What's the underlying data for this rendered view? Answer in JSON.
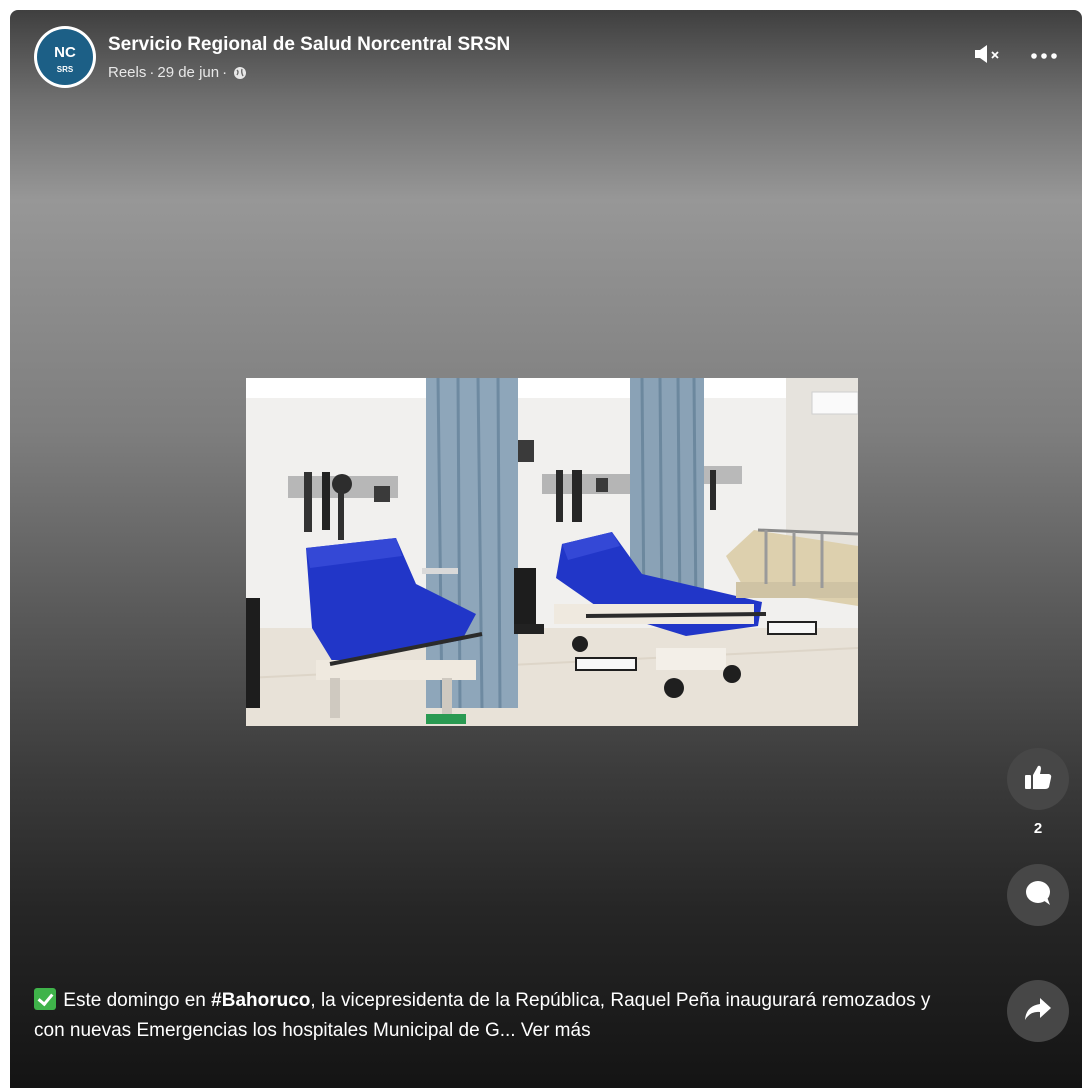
{
  "post": {
    "page_name": "Servicio Regional de Salud Norcentral SRSN",
    "meta_type": "Reels",
    "meta_sep": " · ",
    "meta_date": "29 de jun",
    "avatar_top": "NC",
    "avatar_bottom": "SRS",
    "privacy_icon": "globe-icon"
  },
  "controls": {
    "mute_icon": "speaker-muted-icon",
    "more_label": "···"
  },
  "actions": {
    "like_icon": "thumbs-up-icon",
    "like_count": "2",
    "comment_icon": "comment-bubble-icon",
    "share_icon": "share-arrow-icon"
  },
  "caption": {
    "part1": " Este domingo en ",
    "hashtag": "#Bahoruco",
    "part2": ", la vicepresidenta de la República, Raquel Peña inaugurará remozados y con nuevas Emergencias los hospitales Municipal de G... ",
    "see_more": "Ver más"
  },
  "colors": {
    "accent_check": "#3fb34a",
    "avatar_blue": "#1c5f86",
    "action_bg": "#474747",
    "bed_blue": "#2136c8"
  }
}
